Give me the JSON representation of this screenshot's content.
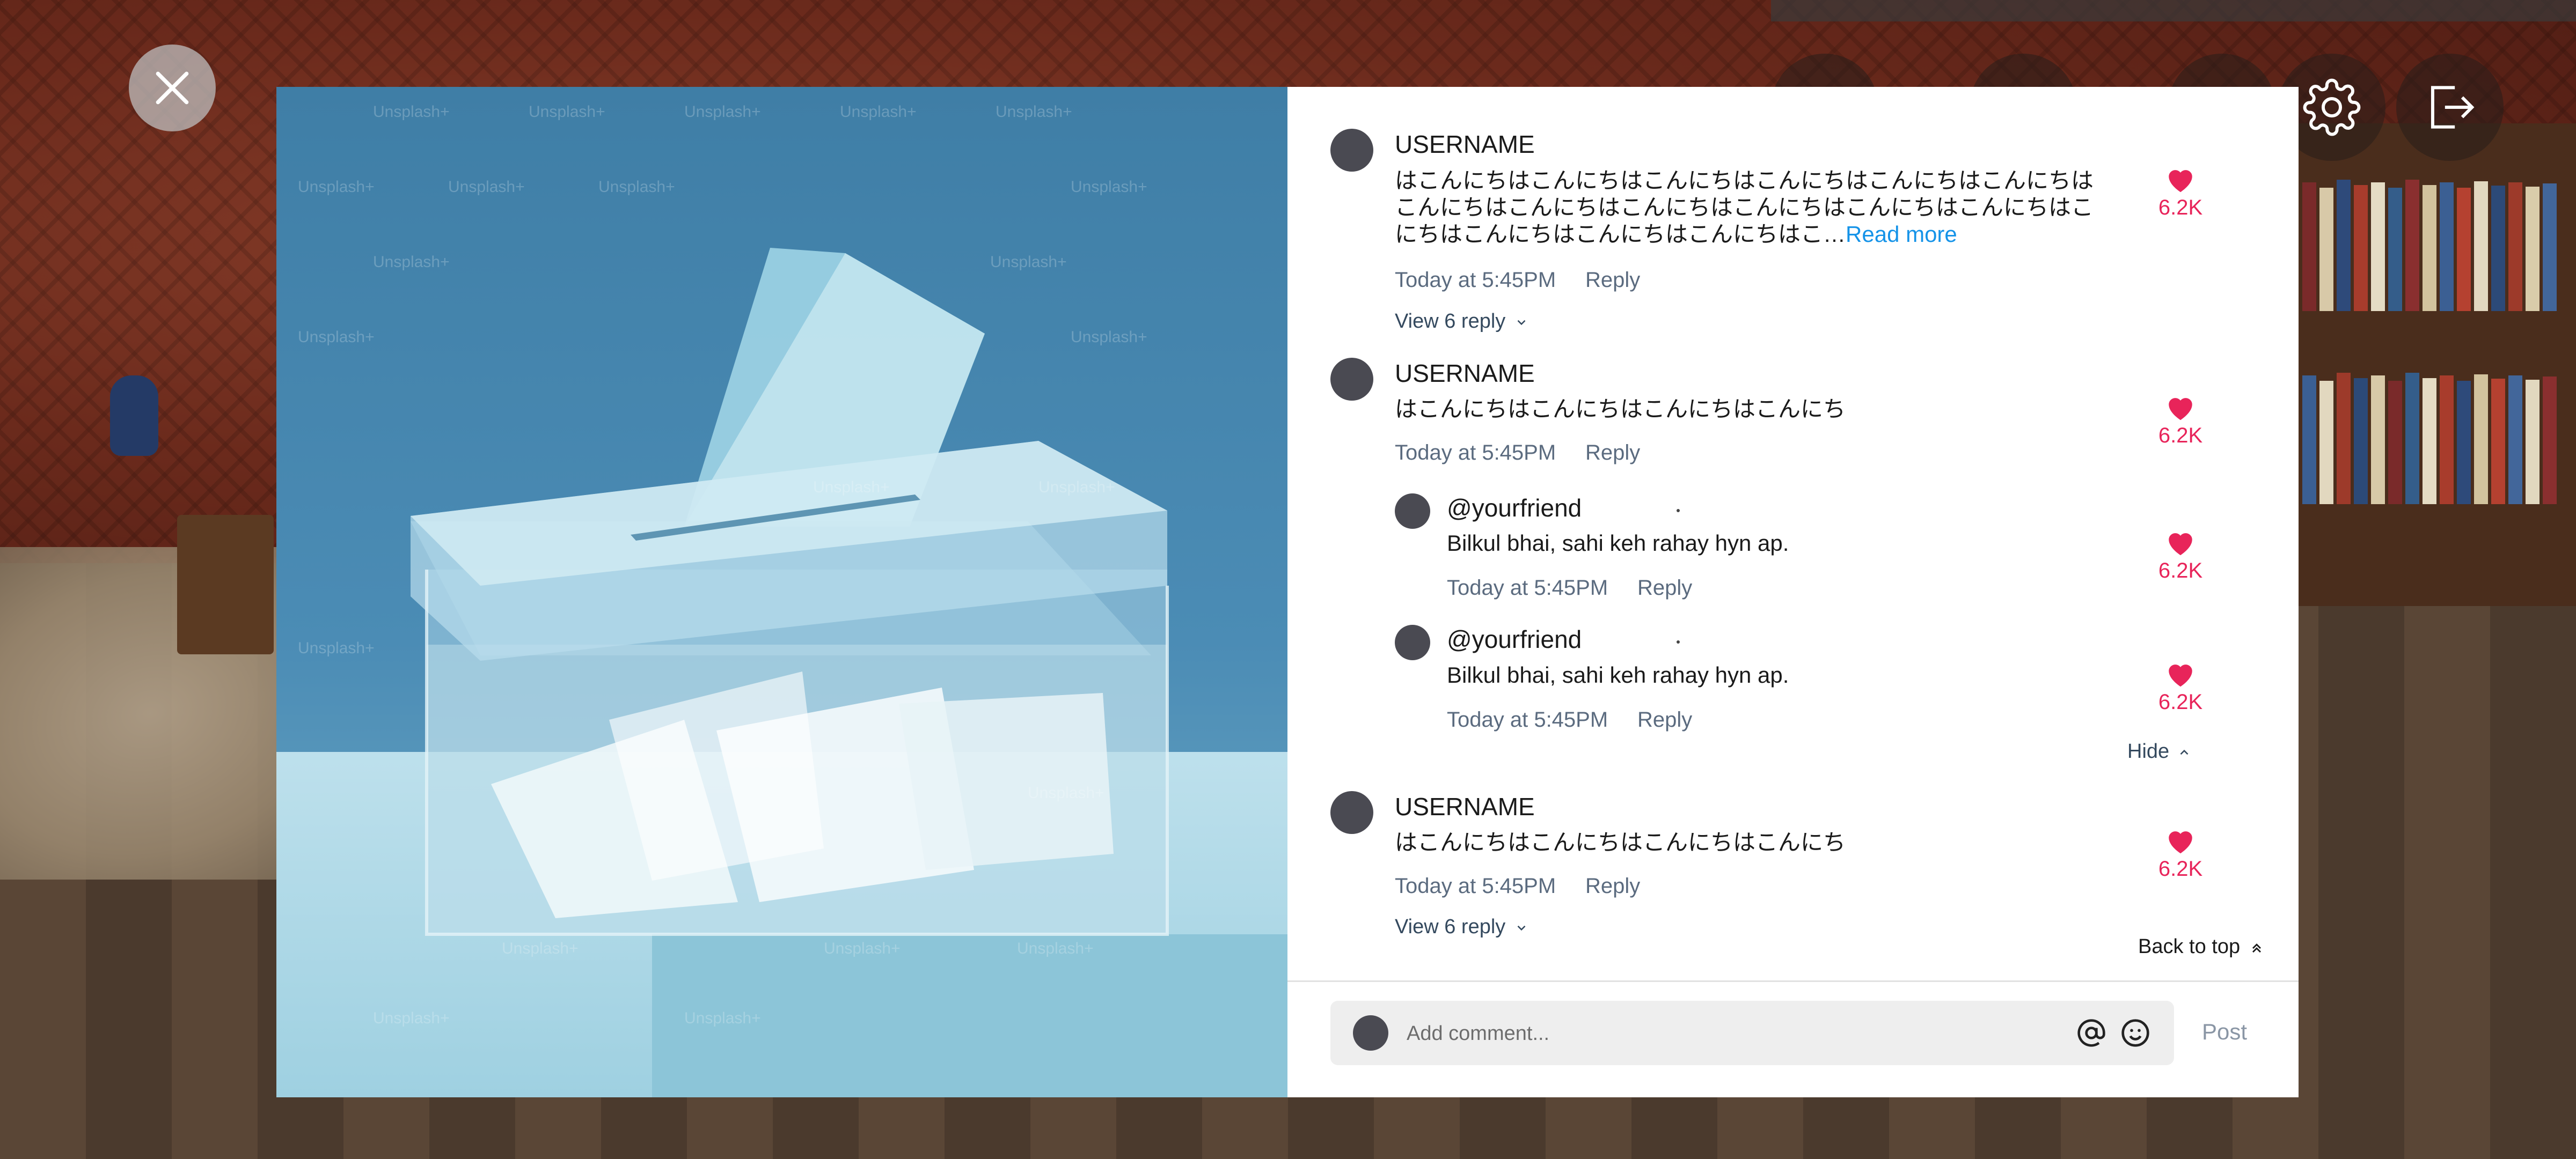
{
  "toolbar": {
    "close_icon": "close-icon",
    "settings_icon": "gear-icon",
    "exit_icon": "exit-icon"
  },
  "media": {
    "watermark": "Unsplash+"
  },
  "comments": [
    {
      "username": "USERNAME",
      "text": "はこんにちはこんにちはこんにちはこんにちはこんにちはこんにちはこんにちはこんにちはこんにちはこんにちはこんにちはこんにちはこんにちはこんにちはこんにちはこんにちはこ…",
      "text_lines": [
        "はこんにちはこんにちはこんにちはこんにちはこんにちはこんにちは",
        "こんにちはこんにちはこんにちはこんにちはこんにちはこんにちはこ",
        "にちはこんにちはこんにちはこんにちはこ…"
      ],
      "read_more": "Read more",
      "time": "Today at 5:45PM",
      "reply_label": "Reply",
      "likes": "6.2K",
      "view_replies": "View 6 reply"
    },
    {
      "username": "USERNAME",
      "text": "はこんにちはこんにちはこんにちはこんにち",
      "time": "Today at 5:45PM",
      "reply_label": "Reply",
      "likes": "6.2K",
      "replies": [
        {
          "username": "@yourfriend",
          "text": "Bilkul bhai, sahi keh rahay hyn ap.",
          "time": "Today at 5:45PM",
          "reply_label": "Reply",
          "likes": "6.2K"
        },
        {
          "username": "@yourfriend",
          "text": "Bilkul bhai, sahi keh rahay hyn ap.",
          "time": "Today at 5:45PM",
          "reply_label": "Reply",
          "likes": "6.2K"
        }
      ],
      "hide_label": "Hide"
    },
    {
      "username": "USERNAME",
      "text": "はこんにちはこんにちはこんにちはこんにち",
      "time": "Today at 5:45PM",
      "reply_label": "Reply",
      "likes": "6.2K",
      "view_replies": "View 6 reply"
    }
  ],
  "back_to_top": "Back to top",
  "composer": {
    "placeholder": "Add comment...",
    "post_label": "Post",
    "mention_icon": "at-icon",
    "emoji_icon": "emoji-icon"
  },
  "colors": {
    "like": "#e8245a",
    "link": "#1593e8",
    "muted": "#5b6b7f"
  }
}
